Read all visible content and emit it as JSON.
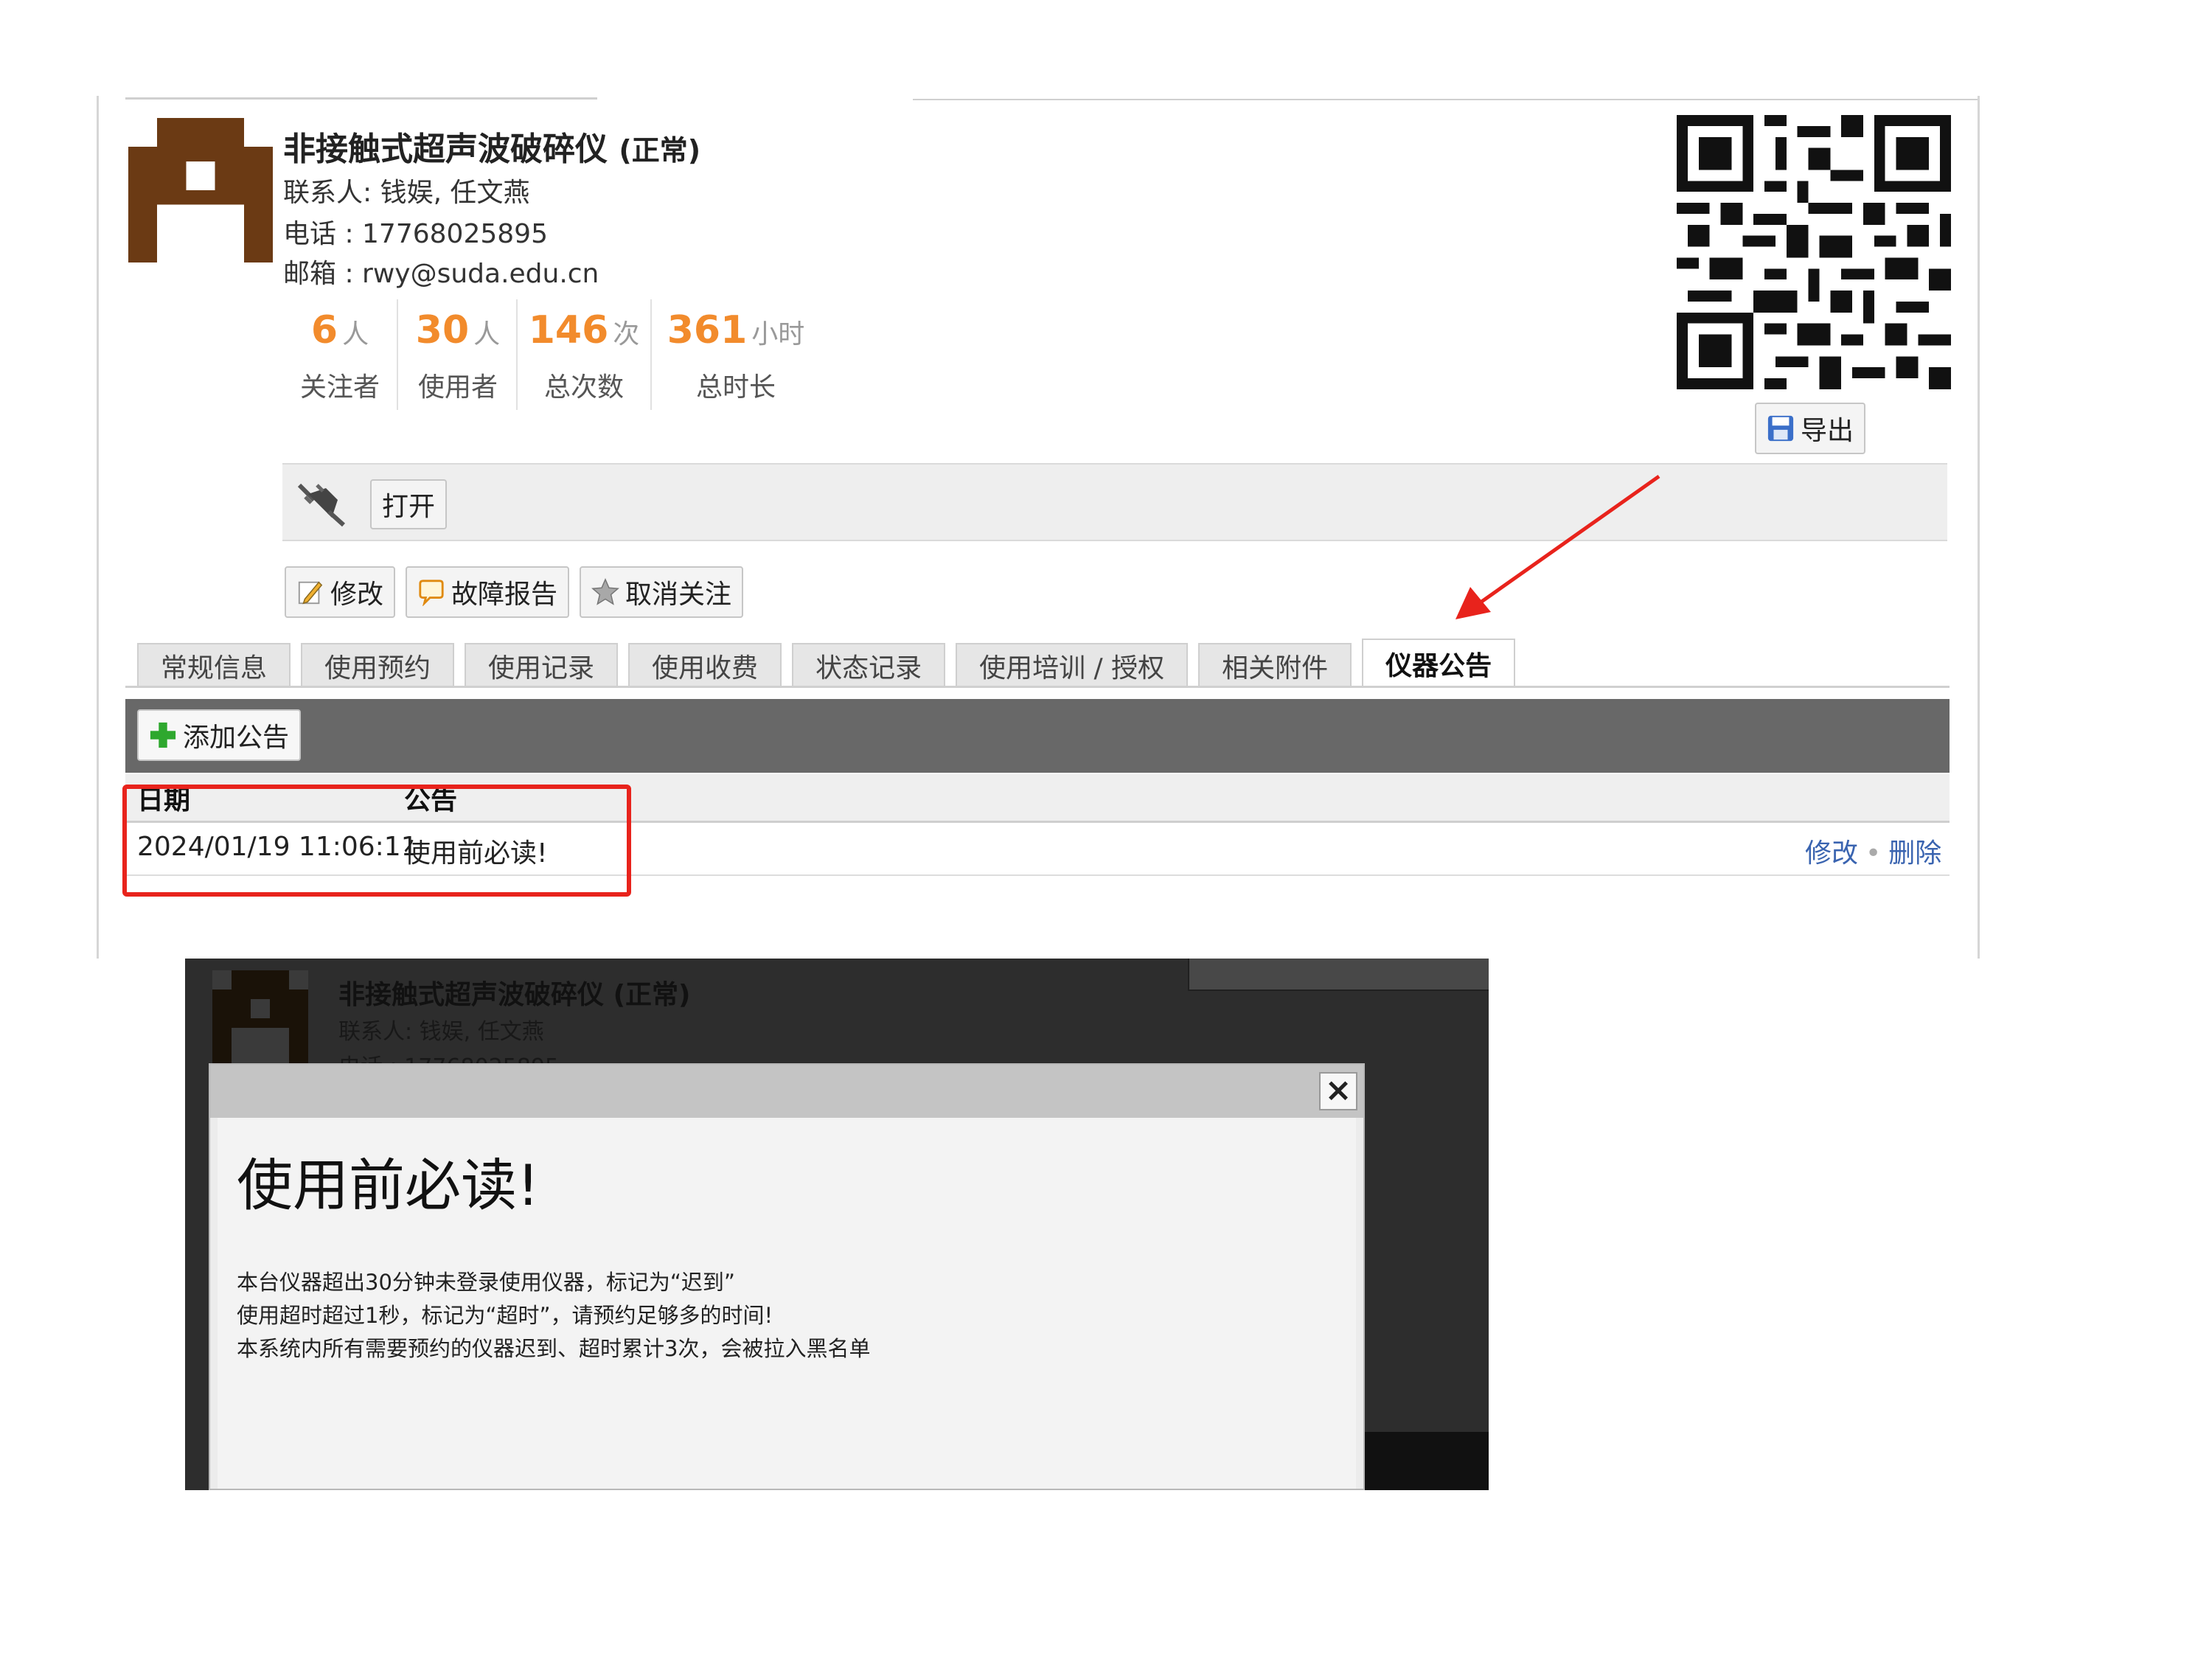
{
  "instrument": {
    "name": "非接触式超声波破碎仪",
    "status": "(正常)",
    "contact_label": "联系人:",
    "contact_names": "钱娱, 任文燕",
    "phone_label": "电话 :",
    "phone": "17768025895",
    "email_label": "邮箱 :",
    "email": "rwy@suda.edu.cn"
  },
  "stats": [
    {
      "value": "6",
      "unit": "人",
      "label": "关注者"
    },
    {
      "value": "30",
      "unit": "人",
      "label": "使用者"
    },
    {
      "value": "146",
      "unit": "次",
      "label": "总次数"
    },
    {
      "value": "361",
      "unit": "小时",
      "label": "总时长"
    }
  ],
  "export_button": "导出",
  "control": {
    "plug_icon": "plug-icon",
    "open_button": "打开"
  },
  "actions": [
    "修改",
    "故障报告",
    "取消关注"
  ],
  "tabs": [
    "常规信息",
    "使用预约",
    "使用记录",
    "使用收费",
    "状态记录",
    "使用培训 / 授权",
    "相关附件",
    "仪器公告"
  ],
  "active_tab": "仪器公告",
  "add_announcement_button": "添加公告",
  "table": {
    "headers": [
      "日期",
      "公告"
    ],
    "rows": [
      {
        "date": "2024/01/19 11:06:11",
        "announcement": "使用前必读!",
        "edit": "修改",
        "sep": "•",
        "delete": "删除"
      }
    ]
  },
  "dialog": {
    "background_title": "非接触式超声波破碎仪",
    "background_status": "(正常)",
    "background_contact": "联系人: 钱娱, 任文燕",
    "background_phone": "电话 : 17768025895",
    "close_symbol": "×",
    "title": "使用前必读!",
    "lines": [
      "本台仪器超出30分钟未登录使用仪器，标记为“迟到”",
      "使用超时超过1秒，标记为“超时”，请预约足够多的时间!",
      "本系统内所有需要预约的仪器迟到、超时累计3次，会被拉入黑名单"
    ]
  },
  "colors": {
    "stat_number": "#f28b2c",
    "link": "#3a64b0",
    "highlight": "#e8231c",
    "avatar": "#6b3a14"
  }
}
